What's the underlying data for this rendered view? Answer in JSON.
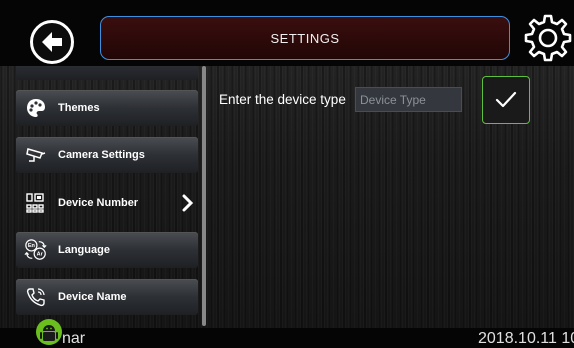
{
  "header": {
    "title": "SETTINGS",
    "back_icon": "back-arrow-icon",
    "settings_icon": "gear-icon"
  },
  "sidebar": {
    "items": [
      {
        "label": "Themes",
        "icon": "palette-icon"
      },
      {
        "label": "Camera Settings",
        "icon": "camera-icon"
      },
      {
        "label": "Device Number",
        "icon": "device-number-icon",
        "active": true
      },
      {
        "label": "Language",
        "icon": "language-icon"
      },
      {
        "label": "Device Name",
        "icon": "phone-icon"
      }
    ]
  },
  "main": {
    "device_type_label": "Enter the device type",
    "device_type_placeholder": "Device Type",
    "device_type_value": "",
    "confirm_icon": "checkmark-icon"
  },
  "status_bar": {
    "left_text": "nar",
    "right_text": "2018.10.11  10:"
  },
  "colors": {
    "accent_blue": "#3f8fe0",
    "title_bg": "#2a0808",
    "confirm_green": "#5fbf3f"
  }
}
